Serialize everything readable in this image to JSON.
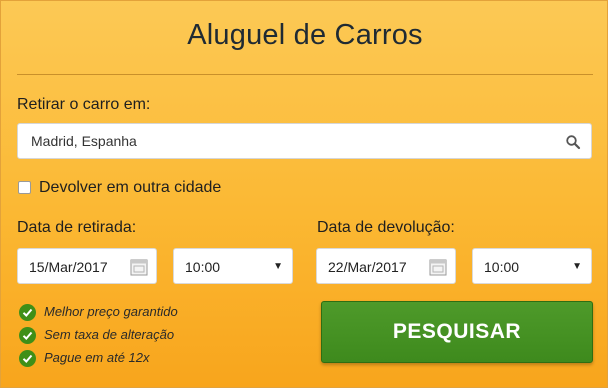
{
  "widget": {
    "title": "Aluguel de Carros",
    "pickup_label": "Retirar o carro em:",
    "pickup_location": "Madrid, Espanha",
    "return_other_city_label": "Devolver em outra cidade",
    "pickup_date_label": "Data de retirada:",
    "pickup_date": "15/Mar/2017",
    "pickup_time": "10:00",
    "return_date_label": "Data de devolução:",
    "return_date": "22/Mar/2017",
    "return_time": "10:00",
    "benefits": [
      "Melhor preço garantido",
      "Sem taxa de alteração",
      "Pague em até 12x"
    ],
    "search_button": "PESQUISAR"
  },
  "colors": {
    "background_top": "#fcc955",
    "background_bottom": "#f8a51c",
    "button_green": "#3e8a1d",
    "check_green": "#3f8f17"
  },
  "icons": [
    "search-icon",
    "calendar-icon",
    "chevron-down-icon",
    "check-circle-icon"
  ],
  "state": {
    "return_other_city_checked": false
  }
}
